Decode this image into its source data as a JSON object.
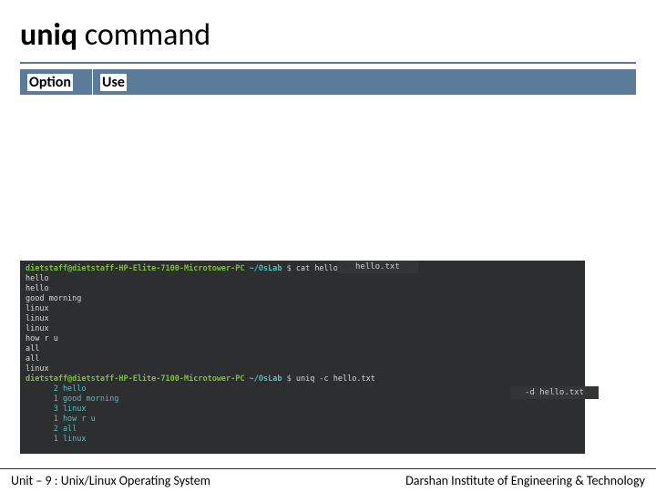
{
  "title": {
    "bold": "uniq",
    "normal": " command"
  },
  "table": {
    "headers": [
      "Option",
      "Use"
    ]
  },
  "terminal": {
    "prompt": {
      "user": "dietstaff@dietstaff-HP-Elite-7100-Microtower-PC",
      "path": "~/OsLab",
      "sym": " $ "
    },
    "cmd1": "cat hello.txt",
    "cat_output": [
      "hello",
      "hello",
      "good morning",
      "linux",
      "linux",
      "linux",
      "how r u",
      "all",
      "all",
      "linux"
    ],
    "cmd2": "uniq -c hello.txt",
    "uniq_output": [
      "      2 hello",
      "      1 good morning",
      "      3 linux",
      "      1 how r u",
      "      2 all",
      "      1 linux"
    ]
  },
  "overlays": [
    "hello.txt",
    "-d hello.txt"
  ],
  "footer": {
    "left": "Unit – 9  : Unix/Linux Operating System",
    "right": "Darshan Institute of Engineering & Technology"
  }
}
